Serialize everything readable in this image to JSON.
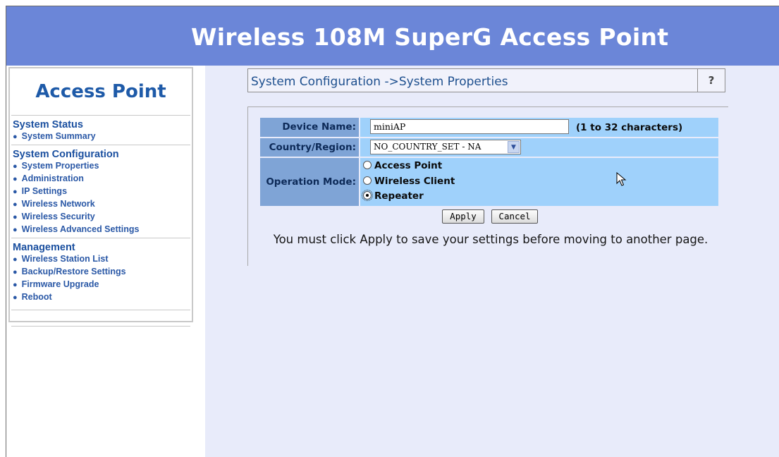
{
  "header": {
    "title": "Wireless 108M SuperG Access Point"
  },
  "sidebar": {
    "title": "Access Point",
    "groups": [
      {
        "title": "System Status",
        "items": [
          "System Summary"
        ]
      },
      {
        "title": "System Configuration",
        "items": [
          "System Properties",
          "Administration",
          "IP Settings",
          "Wireless Network",
          "Wireless Security",
          "Wireless Advanced Settings"
        ]
      },
      {
        "title": "Management",
        "items": [
          "Wireless Station List",
          "Backup/Restore Settings",
          "Firmware Upgrade",
          "Reboot"
        ]
      }
    ]
  },
  "breadcrumb": {
    "text": "System Configuration ->System Properties",
    "help": "?"
  },
  "form": {
    "device_name": {
      "label": "Device Name:",
      "value": "miniAP",
      "hint": "(1 to 32 characters)"
    },
    "country": {
      "label": "Country/Region:",
      "value": "NO_COUNTRY_SET - NA"
    },
    "operation_mode": {
      "label": "Operation Mode:",
      "options": [
        "Access Point",
        "Wireless Client",
        "Repeater"
      ],
      "selected": "Repeater"
    },
    "apply": "Apply",
    "cancel": "Cancel",
    "notice": "You must click Apply to save your settings before moving to another page."
  },
  "icons": {
    "select_arrow": "chevron-down-icon",
    "pointer": "mouse-pointer-icon",
    "bullet": "bullet-icon"
  },
  "colors": {
    "header": "#6b86d8",
    "label_cell": "#7fa4d6",
    "value_cell": "#9fd1fb",
    "content_bg": "#e8ebfa"
  }
}
